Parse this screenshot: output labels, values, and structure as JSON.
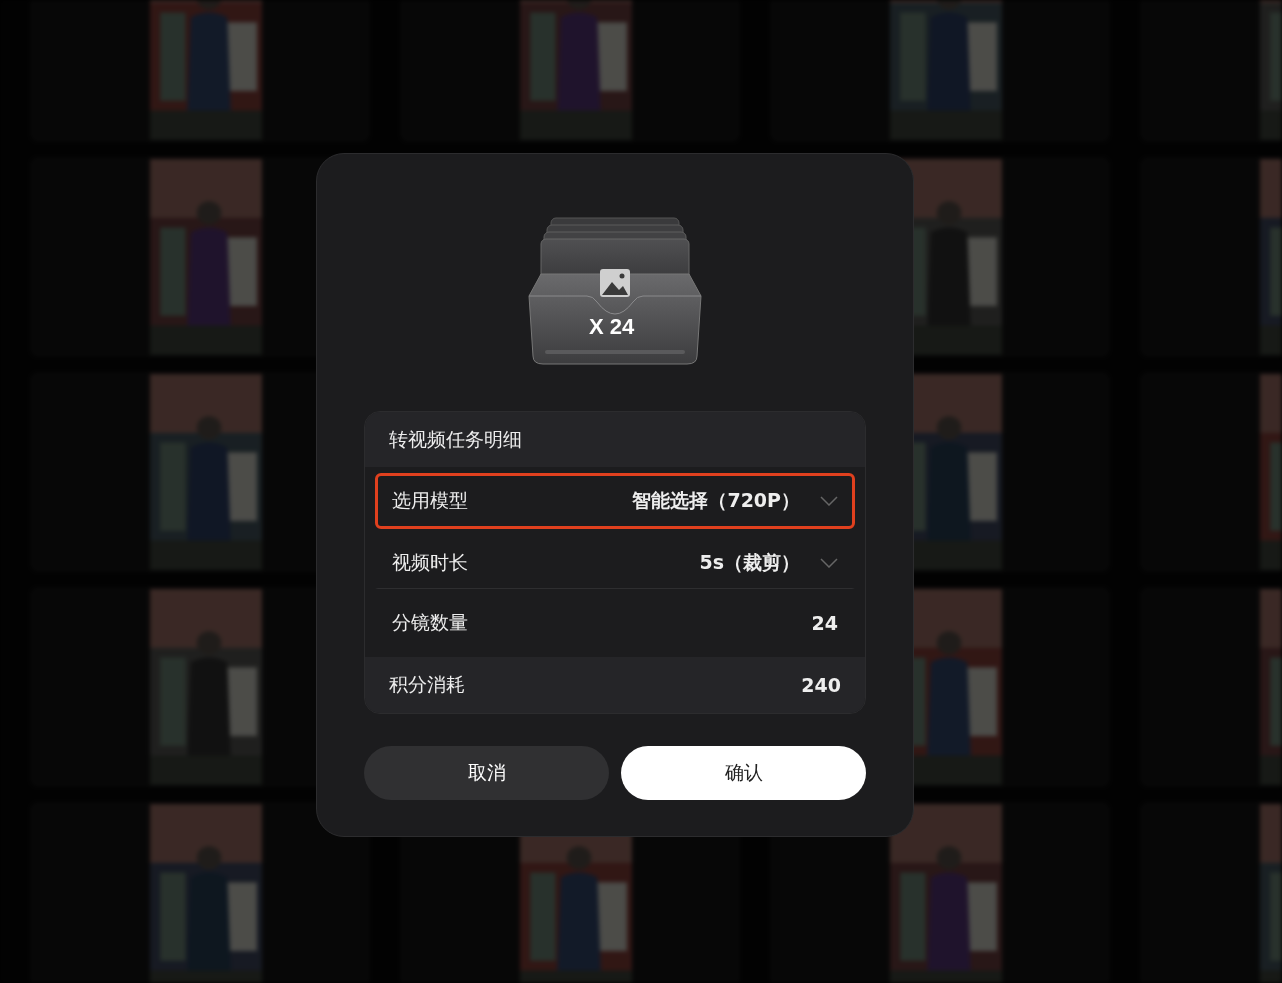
{
  "dialog": {
    "badge": "X 24",
    "details": {
      "title": "转视频任务明细",
      "rows": [
        {
          "kind": "select",
          "label": "选用模型",
          "value": "智能选择（720P）",
          "selected": true
        },
        {
          "kind": "select",
          "label": "视频时长",
          "value": "5s（裁剪）",
          "selected": false
        },
        {
          "kind": "value",
          "label": "分镜数量",
          "value": "24"
        },
        {
          "kind": "total",
          "label": "积分消耗",
          "value": "240"
        }
      ]
    },
    "buttons": [
      {
        "kind": "secondary",
        "label": "取消"
      },
      {
        "kind": "primary",
        "label": "确认"
      }
    ]
  }
}
